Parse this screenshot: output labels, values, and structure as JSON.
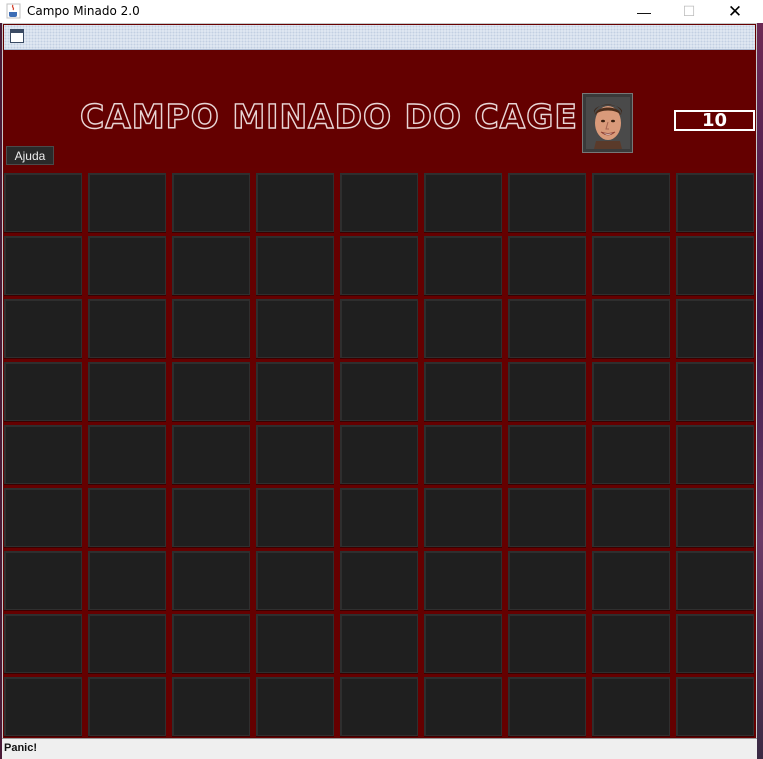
{
  "window": {
    "title": "Campo Minado 2.0",
    "controls": {
      "minimize": "—",
      "maximize": "☐",
      "close": "✕"
    }
  },
  "header": {
    "game_title": "CAMPO MINADO DO CAGE",
    "mine_counter": "10",
    "help_label": "Ajuda"
  },
  "board": {
    "rows": 9,
    "cols": 9
  },
  "status": {
    "text": "Panic!"
  },
  "colors": {
    "background": "#650000",
    "cell": "#1f1f1f"
  }
}
